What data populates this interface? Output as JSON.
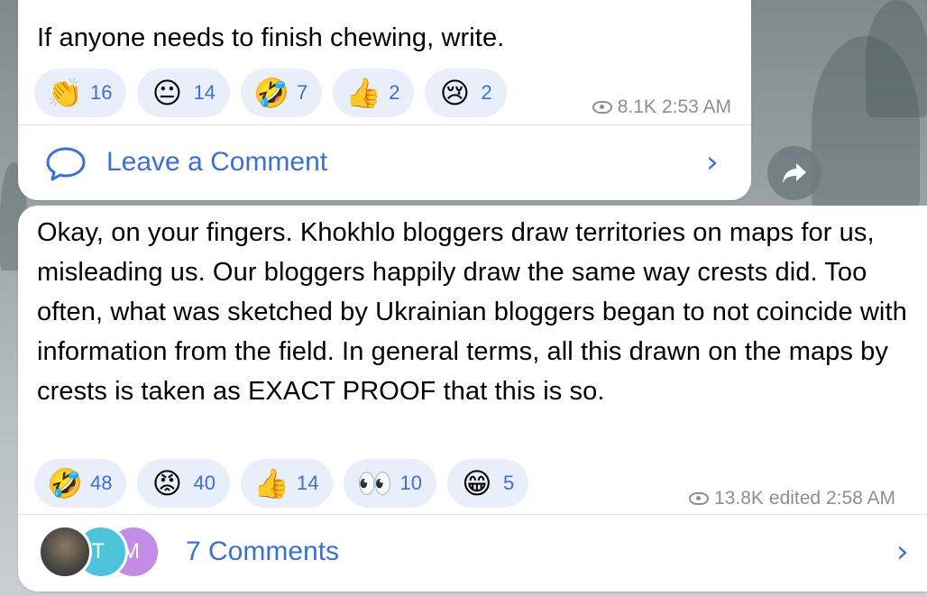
{
  "message1": {
    "text": "If anyone needs to finish chewing, write.",
    "reactions": [
      {
        "emoji": "👏",
        "count": "16"
      },
      {
        "emoji": "😐",
        "count": "14"
      },
      {
        "emoji": "🤣",
        "count": "7"
      },
      {
        "emoji": "👍",
        "count": "2"
      },
      {
        "emoji": "😢",
        "count": "2"
      }
    ],
    "views": "8.1K",
    "time": "2:53 AM",
    "comment_label": "Leave a Comment"
  },
  "message2": {
    "text": "Okay, on your fingers. Khokhlo bloggers draw territories on maps for us, misleading us. Our bloggers happily draw the same way crests did. Too often, what was sketched by Ukrainian bloggers began to not coincide with information from the field. In general terms, all this drawn on the maps by crests is taken as EXACT PROOF that this is so.",
    "reactions": [
      {
        "emoji": "🤣",
        "count": "48"
      },
      {
        "emoji": "😡",
        "count": "40"
      },
      {
        "emoji": "👍",
        "count": "14"
      },
      {
        "emoji": "👀",
        "count": "10"
      },
      {
        "emoji": "😁",
        "count": "5"
      }
    ],
    "views": "13.8K",
    "time": "edited 2:58 AM",
    "comment_label": "7 Comments",
    "avatars": [
      "T",
      "M"
    ]
  },
  "icons": {
    "comment": "speech-bubble-icon",
    "chevron": "chevron-right-icon",
    "share": "share-arrow-icon",
    "views": "eye-icon"
  },
  "colors": {
    "accent": "#3c6fd2",
    "chip_bg": "#e9effa",
    "meta": "#8e8e93",
    "avatar_t": "#4cc3d9",
    "avatar_m": "#c38ce6"
  }
}
